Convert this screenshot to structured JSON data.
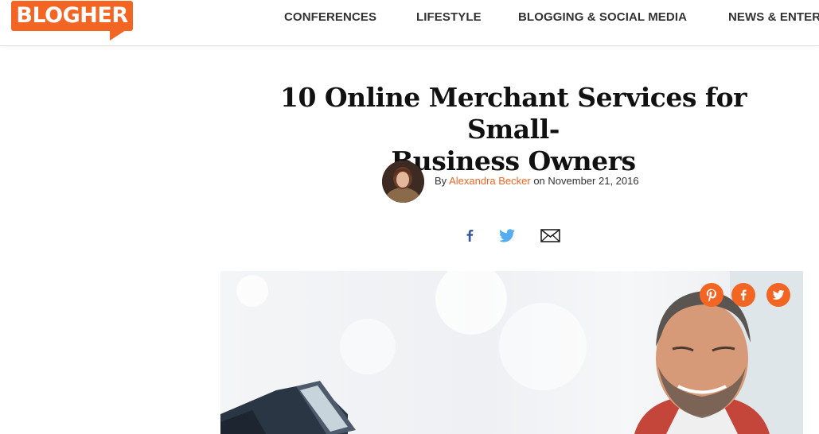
{
  "brand": {
    "logo_text": "BLOGHER",
    "accent": "#f26522"
  },
  "nav": {
    "items": [
      {
        "label": "CONFERENCES"
      },
      {
        "label": "LIFESTYLE"
      },
      {
        "label": "BLOGGING & SOCIAL MEDIA"
      },
      {
        "label": "NEWS & ENTER"
      }
    ]
  },
  "article": {
    "title_line1": "10 Online Merchant Services for Small-",
    "title_line2": "Business Owners",
    "byline_prefix": "By",
    "author": "Alexandra Becker",
    "date_prefix": "on",
    "date": "November 21, 2016"
  },
  "share": {
    "icons": [
      "facebook-icon",
      "twitter-icon",
      "email-icon"
    ],
    "facebook_color": "#3b5998",
    "twitter_color": "#55acee"
  },
  "hero": {
    "overlay_icons": [
      "pinterest-icon",
      "facebook-icon",
      "twitter-icon"
    ]
  }
}
